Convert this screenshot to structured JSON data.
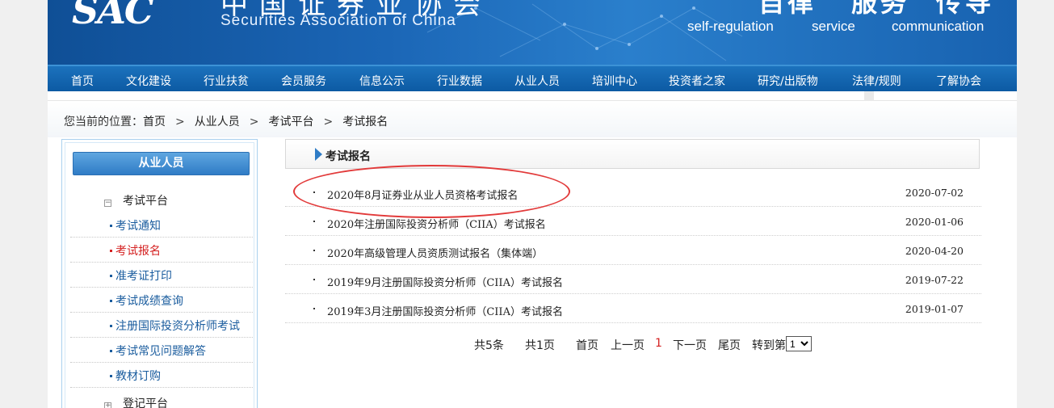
{
  "header": {
    "logo_mark": "SAC",
    "logo_cn": "中国证券业协会",
    "logo_en": "Securities Association of China",
    "slogans": [
      {
        "cn": "自律",
        "en": "self-regulation"
      },
      {
        "cn": "服务",
        "en": "service"
      },
      {
        "cn": "传导",
        "en": "communication"
      }
    ]
  },
  "nav": {
    "items": [
      "首页",
      "文化建设",
      "行业扶贫",
      "会员服务",
      "信息公示",
      "行业数据",
      "从业人员",
      "培训中心",
      "投资者之家",
      "研究/出版物",
      "法律/规则",
      "了解协会"
    ]
  },
  "breadcrumb": {
    "prefix": "您当前的位置：",
    "items": [
      "首页",
      "从业人员",
      "考试平台",
      "考试报名"
    ],
    "separator": ">"
  },
  "sidebar": {
    "title": "从业人员",
    "group1": {
      "label": "考试平台",
      "toggle": "−"
    },
    "links": [
      {
        "label": "考试通知",
        "active": false
      },
      {
        "label": "考试报名",
        "active": true
      },
      {
        "label": "准考证打印",
        "active": false
      },
      {
        "label": "考试成绩查询",
        "active": false
      },
      {
        "label": "注册国际投资分析师考试",
        "active": false
      },
      {
        "label": "考试常见问题解答",
        "active": false
      },
      {
        "label": "教材订购",
        "active": false
      }
    ],
    "group2": {
      "label": "登记平台",
      "toggle": "+"
    }
  },
  "content": {
    "title": "考试报名",
    "rows": [
      {
        "title": "2020年8月证券业从业人员资格考试报名",
        "date": "2020-07-02"
      },
      {
        "title": "2020年注册国际投资分析师（CIIA）考试报名",
        "date": "2020-01-06"
      },
      {
        "title": "2020年高级管理人员资质测试报名（集体端）",
        "date": "2020-04-20"
      },
      {
        "title": "2019年9月注册国际投资分析师（CIIA）考试报名",
        "date": "2019-07-22"
      },
      {
        "title": "2019年3月注册国际投资分析师（CIIA）考试报名",
        "date": "2019-01-07"
      }
    ]
  },
  "pager": {
    "total": "共5条",
    "pages": "共1页",
    "first": "首页",
    "prev": "上一页",
    "current": "1",
    "next": "下一页",
    "last": "尾页",
    "goto": "转到第",
    "selected": "1"
  },
  "colors": {
    "nav_bg": "#0c5aa3",
    "link": "#1a5c9e",
    "active": "#d42020",
    "annotation": "#e23a3a"
  }
}
